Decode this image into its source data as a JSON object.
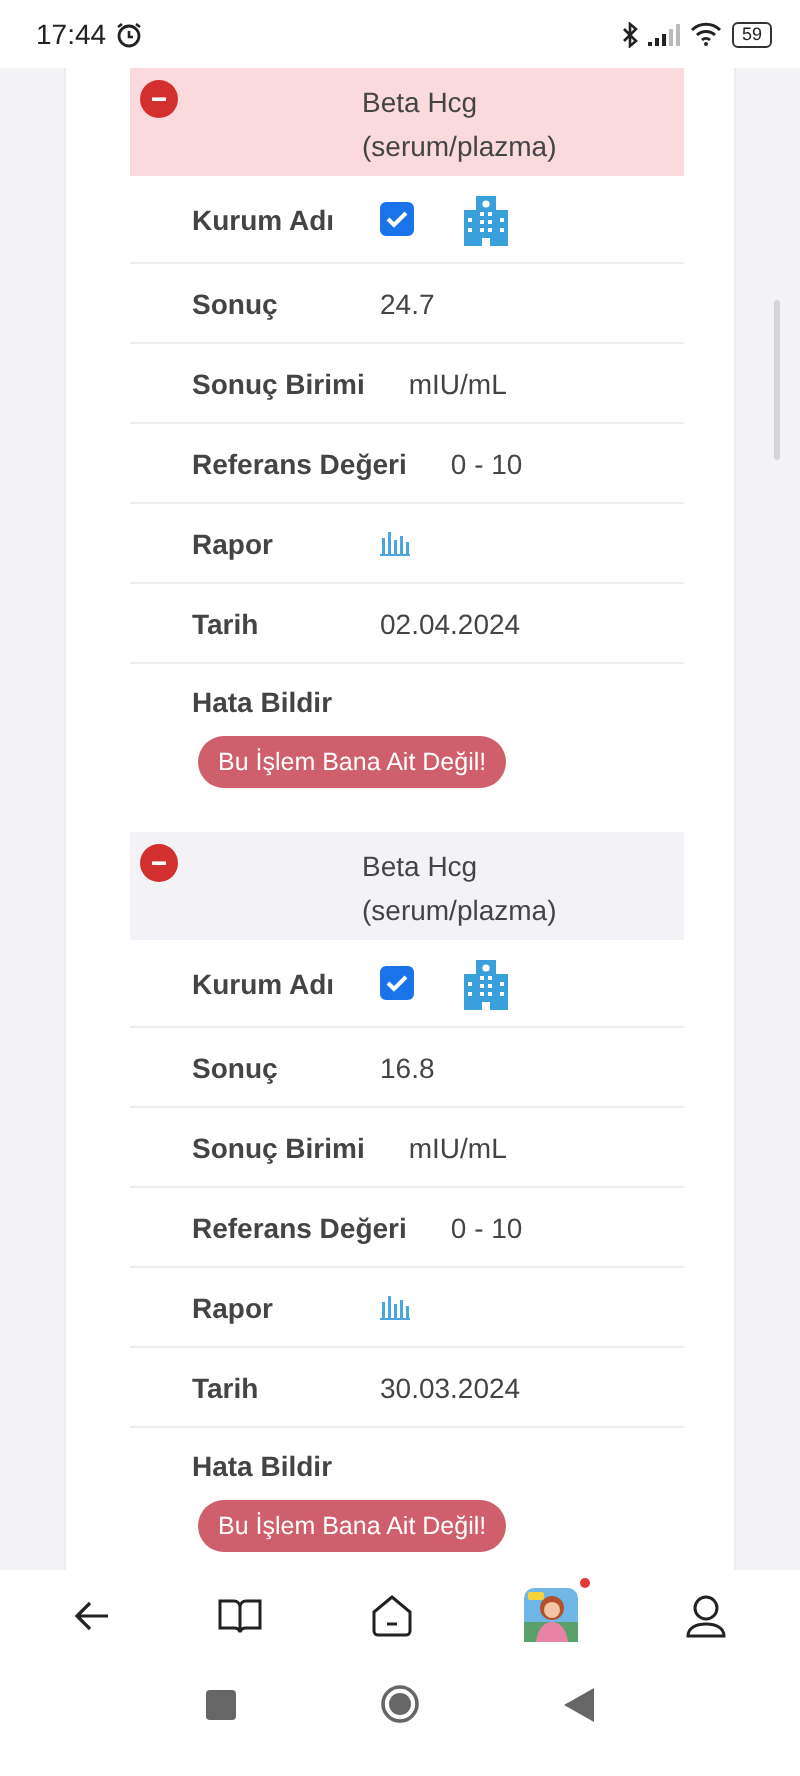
{
  "status_bar": {
    "time": "17:44",
    "battery": "59"
  },
  "results": [
    {
      "title": "Beta Hcg (serum/plazma)",
      "highlighted": true,
      "fields": [
        {
          "kind": "institution",
          "label": "Kurum Adı",
          "checked": true
        },
        {
          "kind": "text",
          "label": "Sonuç",
          "value": "24.7"
        },
        {
          "kind": "text",
          "label": "Sonuç Birimi",
          "value": "mIU/mL"
        },
        {
          "kind": "text",
          "label": "Referans Değeri",
          "value": "0 - 10"
        },
        {
          "kind": "report",
          "label": "Rapor"
        },
        {
          "kind": "text",
          "label": "Tarih",
          "value": "02.04.2024"
        }
      ],
      "error_label": "Hata Bildir",
      "error_button": "Bu İşlem Bana Ait Değil!"
    },
    {
      "title": "Beta Hcg (serum/plazma)",
      "highlighted": false,
      "fields": [
        {
          "kind": "institution",
          "label": "Kurum Adı",
          "checked": true
        },
        {
          "kind": "text",
          "label": "Sonuç",
          "value": "16.8"
        },
        {
          "kind": "text",
          "label": "Sonuç Birimi",
          "value": "mIU/mL"
        },
        {
          "kind": "text",
          "label": "Referans Değeri",
          "value": "0 - 10"
        },
        {
          "kind": "report",
          "label": "Rapor"
        },
        {
          "kind": "text",
          "label": "Tarih",
          "value": "30.03.2024"
        }
      ],
      "error_label": "Hata Bildir",
      "error_button": "Bu İşlem Bana Ait Değil!"
    }
  ],
  "bottom_nav": {
    "notification": true
  }
}
